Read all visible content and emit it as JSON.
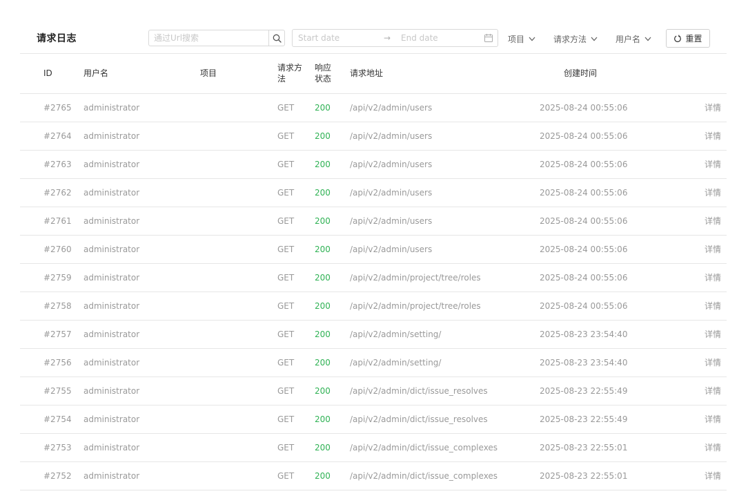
{
  "header": {
    "title": "请求日志",
    "search_placeholder": "通过Url搜索",
    "search_icon": "search-icon",
    "date_start_placeholder": "Start date",
    "date_separator": "→",
    "date_end_placeholder": "End date",
    "calendar_icon": "calendar-icon",
    "filters": {
      "project": "项目",
      "method": "请求方法",
      "user": "用户名"
    },
    "reset_label": "重置"
  },
  "table": {
    "columns": {
      "id": "ID",
      "user": "用户名",
      "project": "项目",
      "method_line1": "请求方",
      "method_line2": "法",
      "status_line1": "响应",
      "status_line2": "状态",
      "url": "请求地址",
      "created": "创建时间"
    },
    "rows": [
      {
        "id": "#2765",
        "user": "administrator",
        "project": "",
        "method": "GET",
        "status": "200",
        "url": "/api/v2/admin/users",
        "created": "2025-08-24 00:55:06",
        "action": "详情"
      },
      {
        "id": "#2764",
        "user": "administrator",
        "project": "",
        "method": "GET",
        "status": "200",
        "url": "/api/v2/admin/users",
        "created": "2025-08-24 00:55:06",
        "action": "详情"
      },
      {
        "id": "#2763",
        "user": "administrator",
        "project": "",
        "method": "GET",
        "status": "200",
        "url": "/api/v2/admin/users",
        "created": "2025-08-24 00:55:06",
        "action": "详情"
      },
      {
        "id": "#2762",
        "user": "administrator",
        "project": "",
        "method": "GET",
        "status": "200",
        "url": "/api/v2/admin/users",
        "created": "2025-08-24 00:55:06",
        "action": "详情"
      },
      {
        "id": "#2761",
        "user": "administrator",
        "project": "",
        "method": "GET",
        "status": "200",
        "url": "/api/v2/admin/users",
        "created": "2025-08-24 00:55:06",
        "action": "详情"
      },
      {
        "id": "#2760",
        "user": "administrator",
        "project": "",
        "method": "GET",
        "status": "200",
        "url": "/api/v2/admin/users",
        "created": "2025-08-24 00:55:06",
        "action": "详情"
      },
      {
        "id": "#2759",
        "user": "administrator",
        "project": "",
        "method": "GET",
        "status": "200",
        "url": "/api/v2/admin/project/tree/roles",
        "created": "2025-08-24 00:55:06",
        "action": "详情"
      },
      {
        "id": "#2758",
        "user": "administrator",
        "project": "",
        "method": "GET",
        "status": "200",
        "url": "/api/v2/admin/project/tree/roles",
        "created": "2025-08-24 00:55:06",
        "action": "详情"
      },
      {
        "id": "#2757",
        "user": "administrator",
        "project": "",
        "method": "GET",
        "status": "200",
        "url": "/api/v2/admin/setting/",
        "created": "2025-08-23 23:54:40",
        "action": "详情"
      },
      {
        "id": "#2756",
        "user": "administrator",
        "project": "",
        "method": "GET",
        "status": "200",
        "url": "/api/v2/admin/setting/",
        "created": "2025-08-23 23:54:40",
        "action": "详情"
      },
      {
        "id": "#2755",
        "user": "administrator",
        "project": "",
        "method": "GET",
        "status": "200",
        "url": "/api/v2/admin/dict/issue_resolves",
        "created": "2025-08-23 22:55:49",
        "action": "详情"
      },
      {
        "id": "#2754",
        "user": "administrator",
        "project": "",
        "method": "GET",
        "status": "200",
        "url": "/api/v2/admin/dict/issue_resolves",
        "created": "2025-08-23 22:55:49",
        "action": "详情"
      },
      {
        "id": "#2753",
        "user": "administrator",
        "project": "",
        "method": "GET",
        "status": "200",
        "url": "/api/v2/admin/dict/issue_complexes",
        "created": "2025-08-23 22:55:01",
        "action": "详情"
      },
      {
        "id": "#2752",
        "user": "administrator",
        "project": "",
        "method": "GET",
        "status": "200",
        "url": "/api/v2/admin/dict/issue_complexes",
        "created": "2025-08-23 22:55:01",
        "action": "详情"
      }
    ]
  },
  "colors": {
    "status_ok": "#2fb254",
    "muted_text": "#999999",
    "border": "#e6e6e6"
  }
}
